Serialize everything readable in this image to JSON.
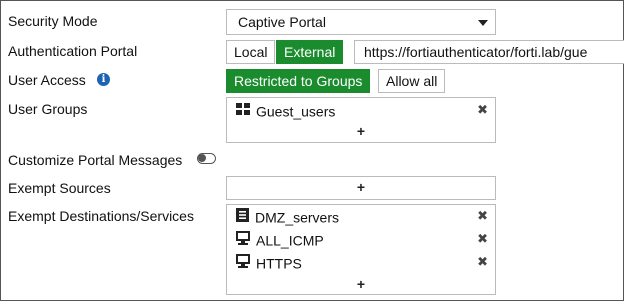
{
  "form": {
    "security_mode": {
      "label": "Security Mode",
      "value": "Captive Portal"
    },
    "auth_portal": {
      "label": "Authentication Portal",
      "options": [
        "Local",
        "External"
      ],
      "selected": "External",
      "url": "https://fortiauthenticator/forti.lab/gue"
    },
    "user_access": {
      "label": "User Access",
      "info_icon": "info-icon",
      "options": [
        "Restricted to Groups",
        "Allow all"
      ],
      "selected": "Restricted to Groups"
    },
    "user_groups": {
      "label": "User Groups",
      "items": [
        {
          "name": "Guest_users",
          "icon": "user-group-icon"
        }
      ],
      "add_label": "+"
    },
    "customize_portal": {
      "label": "Customize Portal Messages",
      "enabled": false
    },
    "exempt_sources": {
      "label": "Exempt Sources",
      "add_label": "+"
    },
    "exempt_destinations": {
      "label": "Exempt Destinations/Services",
      "items": [
        {
          "name": "DMZ_servers",
          "icon": "address-group-icon"
        },
        {
          "name": "ALL_ICMP",
          "icon": "service-icon"
        },
        {
          "name": "HTTPS",
          "icon": "service-icon"
        }
      ],
      "add_label": "+"
    },
    "remove_glyph": "✖"
  },
  "colors": {
    "active_green": "#1b8c2e",
    "info_blue": "#1e63b3",
    "border": "#bbbbbb"
  }
}
